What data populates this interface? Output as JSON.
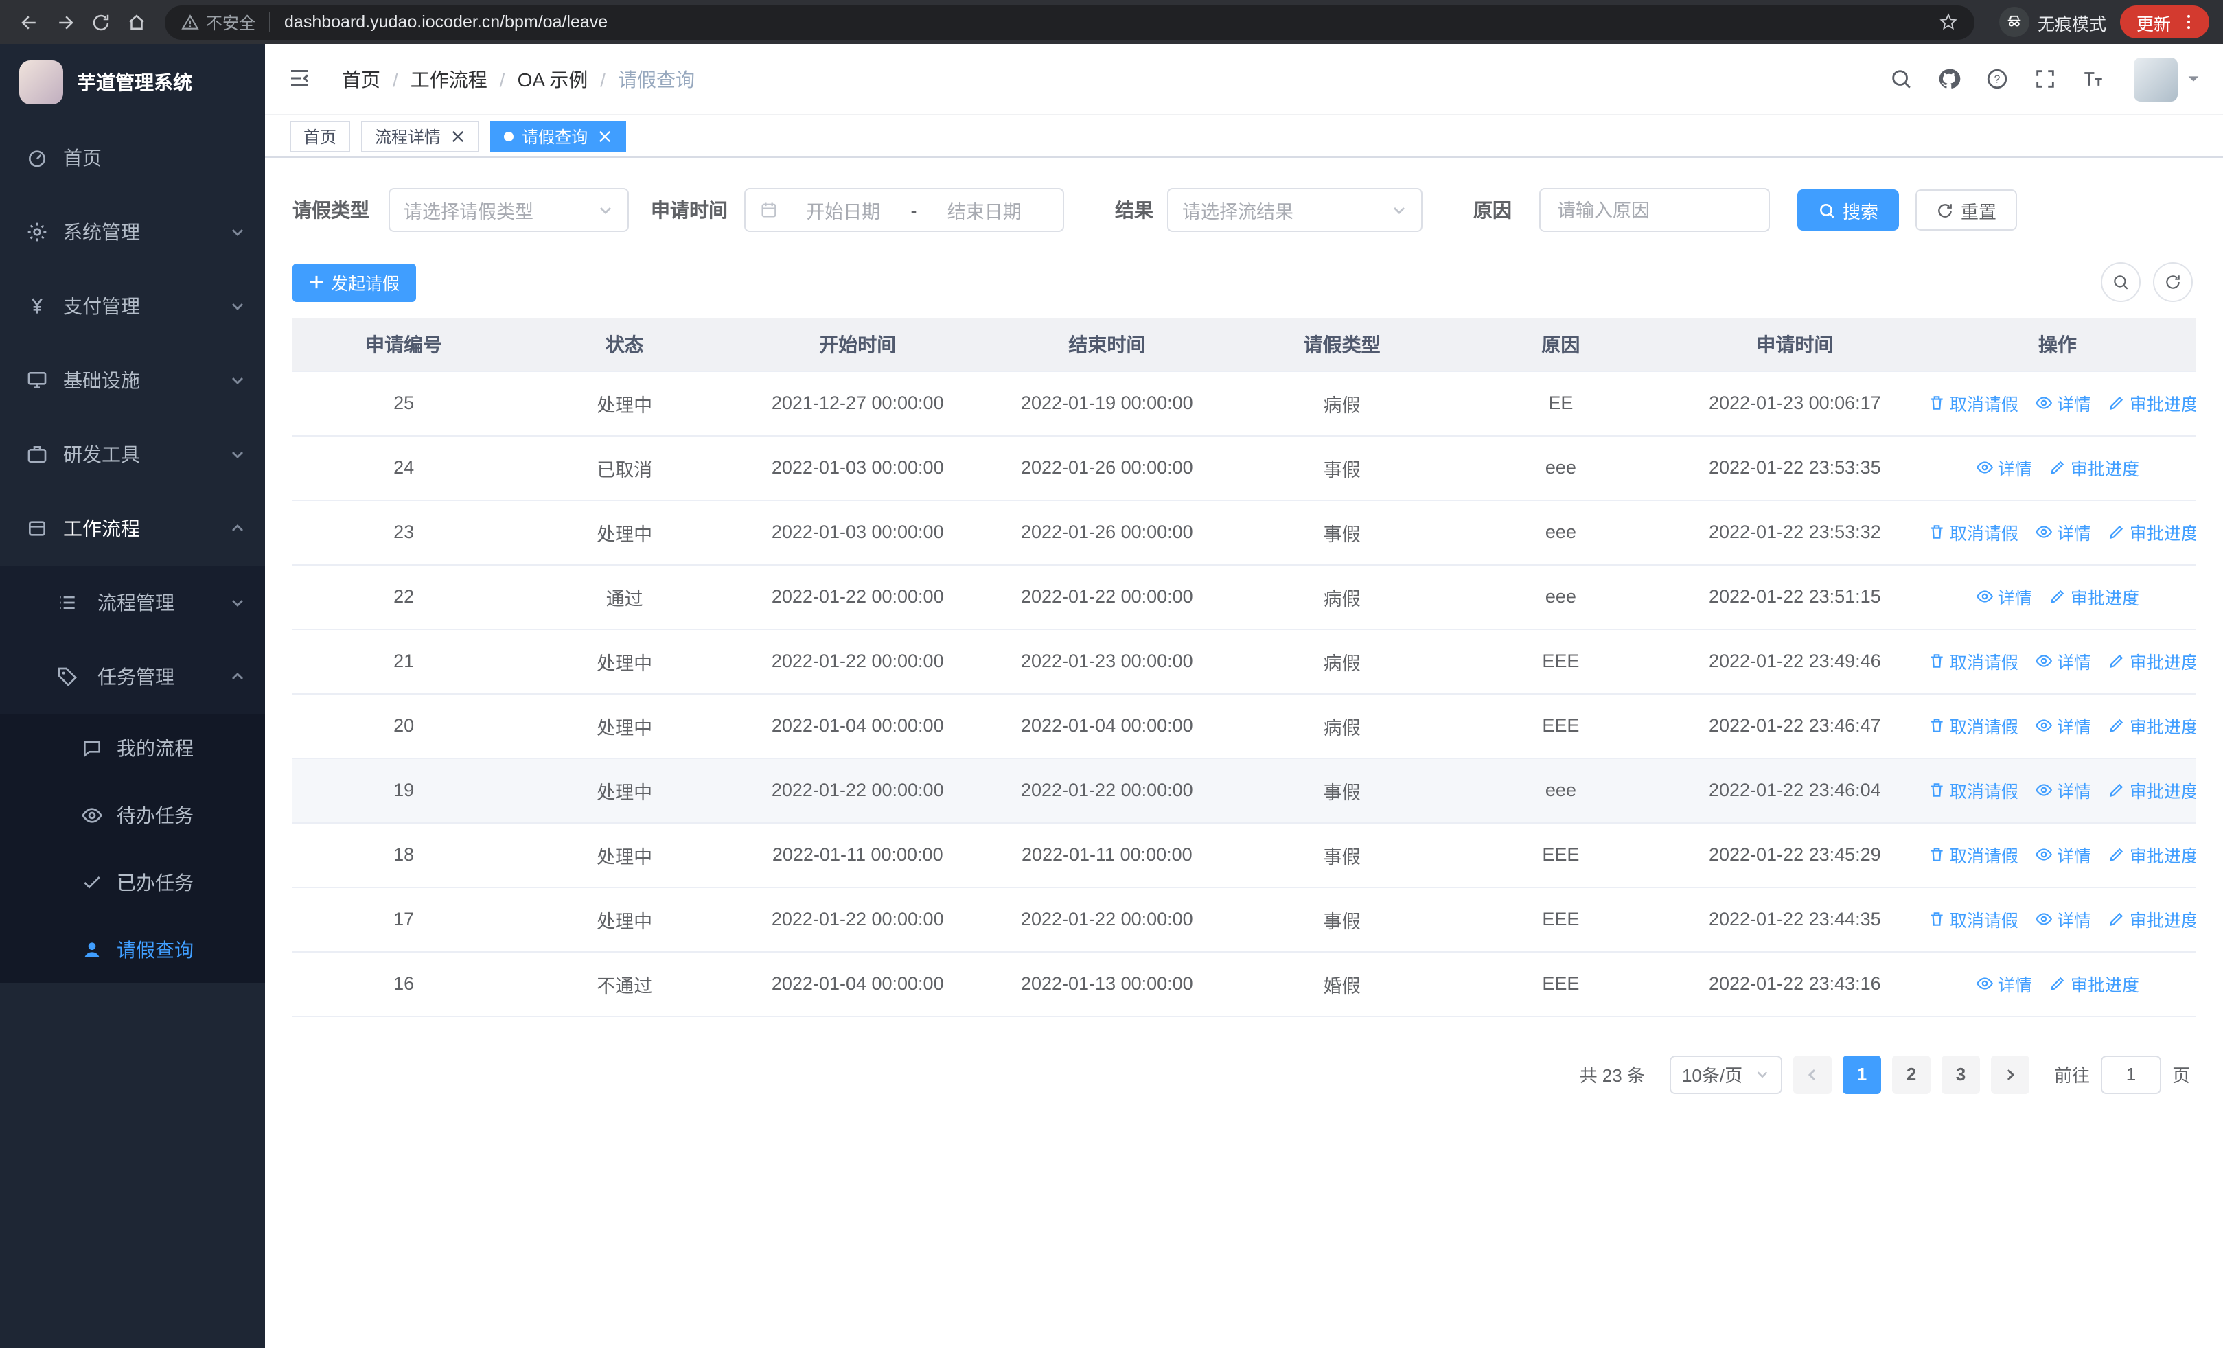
{
  "browser": {
    "security_label": "不安全",
    "url": "dashboard.yudao.iocoder.cn/bpm/oa/leave",
    "incognito_label": "无痕模式",
    "update_label": "更新"
  },
  "sidebar": {
    "app_title": "芋道管理系统",
    "items": [
      {
        "label": "首页"
      },
      {
        "label": "系统管理"
      },
      {
        "label": "支付管理"
      },
      {
        "label": "基础设施"
      },
      {
        "label": "研发工具"
      },
      {
        "label": "工作流程"
      }
    ],
    "workflow_children": [
      {
        "label": "流程管理"
      },
      {
        "label": "任务管理"
      }
    ],
    "task_children": [
      {
        "label": "我的流程"
      },
      {
        "label": "待办任务"
      },
      {
        "label": "已办任务"
      },
      {
        "label": "请假查询"
      }
    ],
    "active_item": "请假查询"
  },
  "header": {
    "breadcrumb": [
      "首页",
      "工作流程",
      "OA 示例",
      "请假查询"
    ],
    "separator": "/"
  },
  "tabs": [
    {
      "label": "首页",
      "active": false,
      "closable": false
    },
    {
      "label": "流程详情",
      "active": false,
      "closable": true
    },
    {
      "label": "请假查询",
      "active": true,
      "closable": true
    }
  ],
  "filters": {
    "leave_type_label": "请假类型",
    "leave_type_placeholder": "请选择请假类型",
    "apply_time_label": "申请时间",
    "start_placeholder": "开始日期",
    "range_separator": "-",
    "end_placeholder": "结束日期",
    "result_label": "结果",
    "result_placeholder": "请选择流结果",
    "reason_label": "原因",
    "reason_placeholder": "请输入原因",
    "search_label": "搜索",
    "reset_label": "重置"
  },
  "toolbar": {
    "create_label": "发起请假"
  },
  "table": {
    "columns": [
      "申请编号",
      "状态",
      "开始时间",
      "结束时间",
      "请假类型",
      "原因",
      "申请时间",
      "操作"
    ],
    "action_labels": {
      "cancel": "取消请假",
      "detail": "详情",
      "progress": "审批进度"
    },
    "rows": [
      {
        "id": "25",
        "status": "处理中",
        "start": "2021-12-27 00:00:00",
        "end": "2022-01-19 00:00:00",
        "type": "病假",
        "reason": "EE",
        "applied": "2022-01-23 00:06:17",
        "actions": [
          "cancel",
          "detail",
          "progress"
        ],
        "highlight": false
      },
      {
        "id": "24",
        "status": "已取消",
        "start": "2022-01-03 00:00:00",
        "end": "2022-01-26 00:00:00",
        "type": "事假",
        "reason": "eee",
        "applied": "2022-01-22 23:53:35",
        "actions": [
          "detail",
          "progress"
        ],
        "highlight": false
      },
      {
        "id": "23",
        "status": "处理中",
        "start": "2022-01-03 00:00:00",
        "end": "2022-01-26 00:00:00",
        "type": "事假",
        "reason": "eee",
        "applied": "2022-01-22 23:53:32",
        "actions": [
          "cancel",
          "detail",
          "progress"
        ],
        "highlight": false
      },
      {
        "id": "22",
        "status": "通过",
        "start": "2022-01-22 00:00:00",
        "end": "2022-01-22 00:00:00",
        "type": "病假",
        "reason": "eee",
        "applied": "2022-01-22 23:51:15",
        "actions": [
          "detail",
          "progress"
        ],
        "highlight": false
      },
      {
        "id": "21",
        "status": "处理中",
        "start": "2022-01-22 00:00:00",
        "end": "2022-01-23 00:00:00",
        "type": "病假",
        "reason": "EEE",
        "applied": "2022-01-22 23:49:46",
        "actions": [
          "cancel",
          "detail",
          "progress"
        ],
        "highlight": false
      },
      {
        "id": "20",
        "status": "处理中",
        "start": "2022-01-04 00:00:00",
        "end": "2022-01-04 00:00:00",
        "type": "病假",
        "reason": "EEE",
        "applied": "2022-01-22 23:46:47",
        "actions": [
          "cancel",
          "detail",
          "progress"
        ],
        "highlight": false
      },
      {
        "id": "19",
        "status": "处理中",
        "start": "2022-01-22 00:00:00",
        "end": "2022-01-22 00:00:00",
        "type": "事假",
        "reason": "eee",
        "applied": "2022-01-22 23:46:04",
        "actions": [
          "cancel",
          "detail",
          "progress"
        ],
        "highlight": true
      },
      {
        "id": "18",
        "status": "处理中",
        "start": "2022-01-11 00:00:00",
        "end": "2022-01-11 00:00:00",
        "type": "事假",
        "reason": "EEE",
        "applied": "2022-01-22 23:45:29",
        "actions": [
          "cancel",
          "detail",
          "progress"
        ],
        "highlight": false
      },
      {
        "id": "17",
        "status": "处理中",
        "start": "2022-01-22 00:00:00",
        "end": "2022-01-22 00:00:00",
        "type": "事假",
        "reason": "EEE",
        "applied": "2022-01-22 23:44:35",
        "actions": [
          "cancel",
          "detail",
          "progress"
        ],
        "highlight": false
      },
      {
        "id": "16",
        "status": "不通过",
        "start": "2022-01-04 00:00:00",
        "end": "2022-01-13 00:00:00",
        "type": "婚假",
        "reason": "EEE",
        "applied": "2022-01-22 23:43:16",
        "actions": [
          "detail",
          "progress"
        ],
        "highlight": false
      }
    ]
  },
  "pagination": {
    "total_label": "共 23 条",
    "page_size_label": "10条/页",
    "pages": [
      "1",
      "2",
      "3"
    ],
    "current_page": "1",
    "goto_label": "前往",
    "goto_value": "1",
    "page_suffix": "页"
  },
  "colors": {
    "accent": "#409eff",
    "sidebar_bg": "#1e2634",
    "submenu_bg": "#171e2d",
    "submenu_deep_bg": "#121826",
    "table_header_bg": "#f0f1f4",
    "update_pill": "#d33a2f"
  }
}
